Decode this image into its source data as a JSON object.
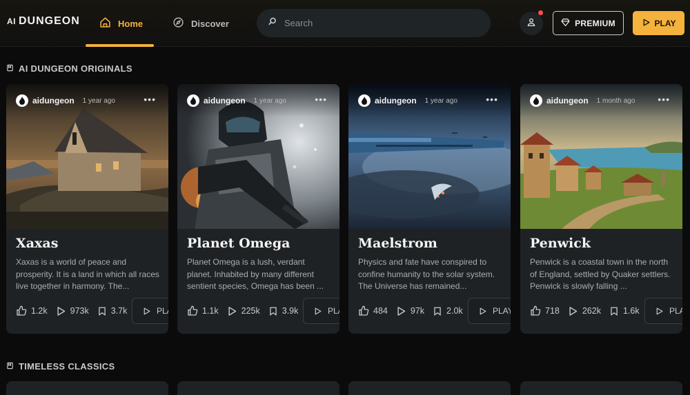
{
  "logo": {
    "prefix": "AI",
    "name": "DUNGEON"
  },
  "nav": {
    "home": "Home",
    "discover": "Discover"
  },
  "search": {
    "placeholder": "Search"
  },
  "header": {
    "premium_label": "PREMIUM",
    "play_label": "PLAY"
  },
  "sections": [
    {
      "title": "AI DUNGEON ORIGINALS"
    },
    {
      "title": "TIMELESS CLASSICS"
    }
  ],
  "cards": [
    {
      "author": "aidungeon",
      "time": "1 year ago",
      "title": "Xaxas",
      "description": "Xaxas is a world of peace and prosperity. It is a land in which all races live together in harmony. The...",
      "likes": "1.2k",
      "plays": "973k",
      "saves": "3.7k",
      "play_label": "PLAY"
    },
    {
      "author": "aidungeon",
      "time": "1 year ago",
      "title": "Planet Omega",
      "description": "Planet Omega is a lush, verdant planet. Inhabited by many different sentient species, Omega has been ...",
      "likes": "1.1k",
      "plays": "225k",
      "saves": "3.9k",
      "play_label": "PLAY"
    },
    {
      "author": "aidungeon",
      "time": "1 year ago",
      "title": "Maelstrom",
      "description": "Physics and fate have conspired to confine humanity to the solar system. The Universe has remained...",
      "likes": "484",
      "plays": "97k",
      "saves": "2.0k",
      "play_label": "PLAY"
    },
    {
      "author": "aidungeon",
      "time": "1 month ago",
      "title": "Penwick",
      "description": "Penwick is a coastal town in the north of England, settled by Quaker settlers. Penwick is slowly falling ...",
      "likes": "718",
      "plays": "262k",
      "saves": "1.6k",
      "play_label": "PLAY"
    }
  ],
  "colors": {
    "accent": "#f5b23c",
    "background": "#0b0b0c",
    "card": "#1f2224",
    "notification": "#ff4d4d"
  }
}
